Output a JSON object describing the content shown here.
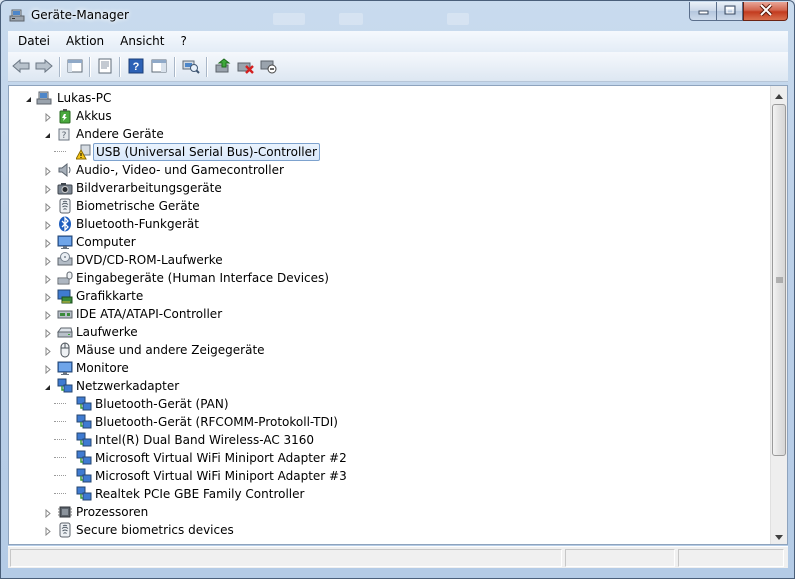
{
  "window": {
    "title": "Geräte-Manager",
    "controls": {
      "minimize": "minimize",
      "maximize": "maximize",
      "close": "close"
    }
  },
  "menu": [
    {
      "label": "Datei"
    },
    {
      "label": "Aktion"
    },
    {
      "label": "Ansicht"
    },
    {
      "label": "?"
    }
  ],
  "toolbar": [
    {
      "icon": "back-arrow-icon"
    },
    {
      "icon": "forward-arrow-icon"
    },
    {
      "icon": "show-hide-console-tree-icon"
    },
    {
      "icon": "properties-icon"
    },
    {
      "icon": "help-icon"
    },
    {
      "icon": "action-pane-icon"
    },
    {
      "icon": "scan-hardware-icon"
    },
    {
      "icon": "update-driver-icon"
    },
    {
      "icon": "uninstall-icon"
    },
    {
      "icon": "disable-device-icon"
    }
  ],
  "tree": {
    "nodes": [
      {
        "label": "Lukas-PC",
        "level": 0,
        "state": "expanded",
        "icon": "computer-icon"
      },
      {
        "label": "Akkus",
        "level": 1,
        "state": "collapsed",
        "icon": "battery-icon"
      },
      {
        "label": "Andere Geräte",
        "level": 1,
        "state": "expanded",
        "icon": "unknown-device-icon"
      },
      {
        "label": "USB (Universal Serial Bus)-Controller",
        "level": 2,
        "state": "leaf",
        "icon": "warning-device-icon",
        "selected": true
      },
      {
        "label": "Audio-, Video- und Gamecontroller",
        "level": 1,
        "state": "collapsed",
        "icon": "speaker-icon"
      },
      {
        "label": "Bildverarbeitungsgeräte",
        "level": 1,
        "state": "collapsed",
        "icon": "camera-icon"
      },
      {
        "label": "Biometrische Geräte",
        "level": 1,
        "state": "collapsed",
        "icon": "fingerprint-icon"
      },
      {
        "label": "Bluetooth-Funkgerät",
        "level": 1,
        "state": "collapsed",
        "icon": "bluetooth-icon"
      },
      {
        "label": "Computer",
        "level": 1,
        "state": "collapsed",
        "icon": "monitor-icon"
      },
      {
        "label": "DVD/CD-ROM-Laufwerke",
        "level": 1,
        "state": "collapsed",
        "icon": "cd-drive-icon"
      },
      {
        "label": "Eingabegeräte (Human Interface Devices)",
        "level": 1,
        "state": "collapsed",
        "icon": "hid-icon"
      },
      {
        "label": "Grafikkarte",
        "level": 1,
        "state": "collapsed",
        "icon": "display-adapter-icon"
      },
      {
        "label": "IDE ATA/ATAPI-Controller",
        "level": 1,
        "state": "collapsed",
        "icon": "ide-controller-icon"
      },
      {
        "label": "Laufwerke",
        "level": 1,
        "state": "collapsed",
        "icon": "disk-drive-icon"
      },
      {
        "label": "Mäuse und andere Zeigegeräte",
        "level": 1,
        "state": "collapsed",
        "icon": "mouse-icon"
      },
      {
        "label": "Monitore",
        "level": 1,
        "state": "collapsed",
        "icon": "monitor-icon"
      },
      {
        "label": "Netzwerkadapter",
        "level": 1,
        "state": "expanded",
        "icon": "network-adapter-icon"
      },
      {
        "label": "Bluetooth-Gerät (PAN)",
        "level": 2,
        "state": "leaf",
        "icon": "network-adapter-icon"
      },
      {
        "label": "Bluetooth-Gerät (RFCOMM-Protokoll-TDI)",
        "level": 2,
        "state": "leaf",
        "icon": "network-adapter-icon"
      },
      {
        "label": "Intel(R) Dual Band Wireless-AC 3160",
        "level": 2,
        "state": "leaf",
        "icon": "network-adapter-icon"
      },
      {
        "label": "Microsoft Virtual WiFi Miniport Adapter #2",
        "level": 2,
        "state": "leaf",
        "icon": "network-adapter-icon"
      },
      {
        "label": "Microsoft Virtual WiFi Miniport Adapter #3",
        "level": 2,
        "state": "leaf",
        "icon": "network-adapter-icon"
      },
      {
        "label": "Realtek PCIe GBE Family Controller",
        "level": 2,
        "state": "leaf",
        "icon": "network-adapter-icon"
      },
      {
        "label": "Prozessoren",
        "level": 1,
        "state": "collapsed",
        "icon": "processor-icon"
      },
      {
        "label": "Secure biometrics devices",
        "level": 1,
        "state": "collapsed",
        "icon": "fingerprint-icon"
      }
    ]
  },
  "colors": {
    "selection_border": "#7da2ce",
    "selection_fill": "#d9e8fb",
    "close_button": "#c33b1f"
  }
}
